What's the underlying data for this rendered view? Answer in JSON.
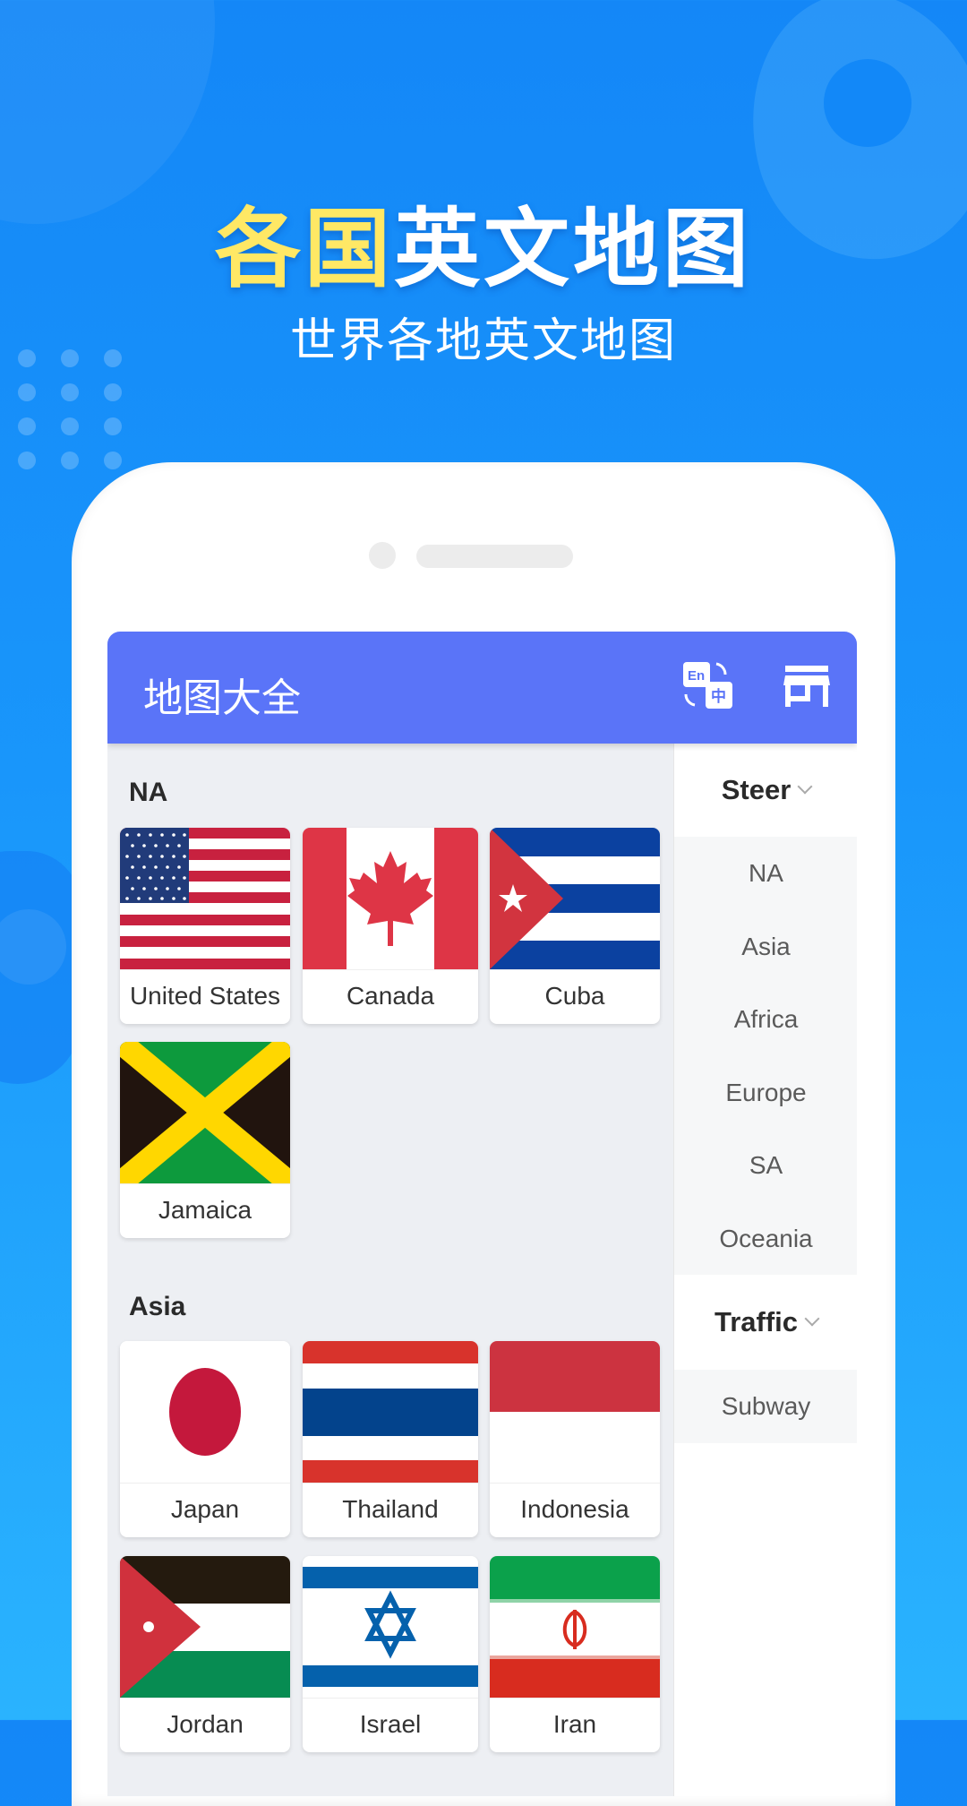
{
  "promo": {
    "headline_yellow": "各国",
    "headline_white": "英文地图",
    "subheadline": "世界各地英文地图"
  },
  "colors": {
    "background_top": "#1487f7",
    "background_bottom": "#2ab3fe",
    "headline_accent": "#FFE865",
    "appbar": "#5A74F8",
    "content_bg": "#EDEFF3",
    "sidebar_item_bg": "#F6F7F8"
  },
  "app": {
    "title": "地图大全",
    "icons": {
      "translate": "translate-en-zh-icon",
      "store": "store-icon"
    }
  },
  "sections": [
    {
      "heading": "NA",
      "countries": [
        {
          "name": "United States",
          "flag": "us"
        },
        {
          "name": "Canada",
          "flag": "ca"
        },
        {
          "name": "Cuba",
          "flag": "cu"
        },
        {
          "name": "Jamaica",
          "flag": "jm"
        }
      ]
    },
    {
      "heading": "Asia",
      "countries": [
        {
          "name": "Japan",
          "flag": "jp"
        },
        {
          "name": "Thailand",
          "flag": "th"
        },
        {
          "name": "Indonesia",
          "flag": "id"
        },
        {
          "name": "Jordan",
          "flag": "jo"
        },
        {
          "name": "Israel",
          "flag": "il"
        },
        {
          "name": "Iran",
          "flag": "ir"
        }
      ]
    }
  ],
  "sidebar": {
    "groups": [
      {
        "label": "Steer",
        "items": [
          "NA",
          "Asia",
          "Africa",
          "Europe",
          "SA",
          "Oceania"
        ]
      },
      {
        "label": "Traffic",
        "items": [
          "Subway"
        ]
      }
    ]
  }
}
